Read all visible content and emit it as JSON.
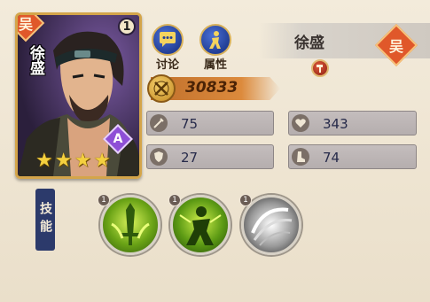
{
  "hero": {
    "name": "徐盛",
    "level": "1",
    "faction_char": "吴",
    "grade": "A",
    "stars": 4
  },
  "actions": {
    "discuss_label": "讨论",
    "attributes_label": "属性"
  },
  "power": {
    "value": "30833"
  },
  "stats": {
    "attack": "75",
    "hp": "343",
    "defense": "27",
    "speed": "74"
  },
  "skills": {
    "label": "技能",
    "items": [
      {
        "level": "1",
        "icon": "green-sword-skill-icon"
      },
      {
        "level": "1",
        "icon": "green-figure-skill-icon"
      },
      {
        "level": "1",
        "icon": "white-swirl-skill-icon"
      }
    ]
  },
  "colors": {
    "accent_orange": "#e0582a",
    "panel_bg": "#efe6d4",
    "stat_box": "#bdb6b6"
  }
}
